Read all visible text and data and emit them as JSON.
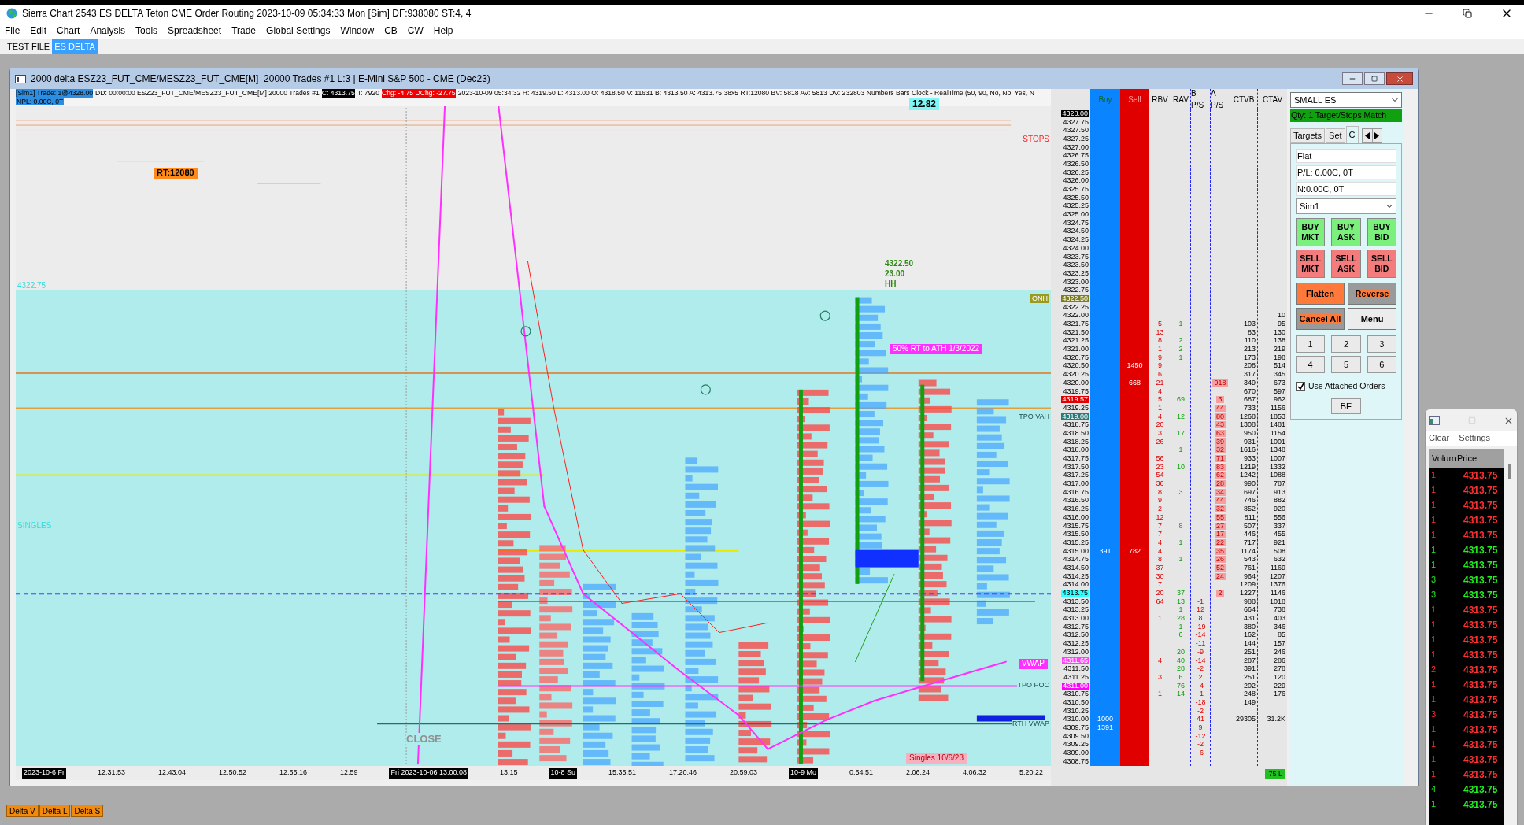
{
  "window": {
    "title": "Sierra Chart 2543 ES DELTA Teton CME Order Routing 2023-10-09 05:34:33 Mon [Sim] DF:938080 ST:4, 4"
  },
  "menu": [
    "File",
    "Edit",
    "Chart",
    "Analysis",
    "Tools",
    "Spreadsheet",
    "Trade",
    "Global Settings",
    "Window",
    "CB",
    "CW",
    "Help"
  ],
  "chartbook_tabs": [
    {
      "label": "TEST FILE",
      "selected": false
    },
    {
      "label": "ES DELTA",
      "selected": true
    }
  ],
  "chart": {
    "title": "2000 delta ESZ23_FUT_CME/MESZ23_FUT_CME[M]  20000 Trades #1 L:3 | E-Mini S&P 500 - CME (Dec23)",
    "info": [
      {
        "text": "[Sim1] Trade: 1@4328.00",
        "kind": "account"
      },
      {
        "text": "DD: 00:00:00 ESZ23_FUT_CME/MESZ23_FUT_CME[M] 20000 Trades #1",
        "kind": "plain"
      },
      {
        "text": "C: 4313.75",
        "kind": "close"
      },
      {
        "text": "T: 7920",
        "kind": "plain"
      },
      {
        "text": "Chg: -4.75 DChg: -27.75",
        "kind": "change"
      },
      {
        "text": "2023-10-09 05:34:32 H: 4319.50 L: 4313.00 O: 4318.50 V: 11631 B: 4313.50 A: 4313.75 38x5 RT:12080 BV: 5818 AV: 5813 DV: 232803 Numbers Bars Clock - RealTime (50, 90, No, No, Yes, N",
        "kind": "plain"
      }
    ],
    "info_line_2": "NPL: 0.00C, 0T",
    "labels": [
      {
        "text": "RT:12080",
        "kind": "tag"
      },
      {
        "text": "STOPS",
        "kind": "red"
      },
      {
        "text": "4322.75",
        "kind": "cyan"
      },
      {
        "text": "SINGLES",
        "kind": "cyan"
      },
      {
        "text": "CLOSE",
        "kind": "grey"
      },
      {
        "text": "12.82",
        "kind": "box"
      },
      {
        "text": "4322.50",
        "kind": "green"
      },
      {
        "text": "23.00",
        "kind": "green"
      },
      {
        "text": "HH",
        "kind": "green"
      },
      {
        "text": "ONH",
        "kind": "olive"
      },
      {
        "text": "50% RT to ATH 1/3/2022",
        "kind": "magenta"
      },
      {
        "text": "TPO VAH",
        "kind": "plain"
      },
      {
        "text": "VWAP",
        "kind": "magenta"
      },
      {
        "text": "TPO POC",
        "kind": "plain"
      },
      {
        "text": "RTH VWAP",
        "kind": "plain"
      },
      {
        "text": "Singles 10/6/23",
        "kind": "pink"
      }
    ],
    "x_axis": [
      {
        "text": "2023-10-6 Fr",
        "boxed": true
      },
      {
        "text": "12:31:53",
        "boxed": false
      },
      {
        "text": "12:43:04",
        "boxed": false
      },
      {
        "text": "12:50:52",
        "boxed": false
      },
      {
        "text": "12:55:16",
        "boxed": false
      },
      {
        "text": "12:59",
        "boxed": false
      },
      {
        "text": "Fri 2023-10-06 13:00:08",
        "boxed": true
      },
      {
        "text": "13:15",
        "boxed": false
      },
      {
        "text": "10-8 Su",
        "boxed": true
      },
      {
        "text": "15:35:51",
        "boxed": false
      },
      {
        "text": "17:20:46",
        "boxed": false
      },
      {
        "text": "20:59:03",
        "boxed": false
      },
      {
        "text": "10-9 Mo",
        "boxed": true
      },
      {
        "text": "0:54:51",
        "boxed": false
      },
      {
        "text": "2:06:24",
        "boxed": false
      },
      {
        "text": "4:06:32",
        "boxed": false
      },
      {
        "text": "5:20:22",
        "boxed": false
      }
    ]
  },
  "ladder": {
    "headers": [
      {
        "text": "Buy",
        "kind": "buy"
      },
      {
        "text": "Sell",
        "kind": "sell"
      },
      {
        "text": "RBV",
        "kind": "rbv"
      },
      {
        "text": "RAV",
        "kind": "rav"
      },
      {
        "text": "B P/S",
        "kind": "bps"
      },
      {
        "text": "A P/S",
        "kind": "aps"
      },
      {
        "text": "CTVB",
        "kind": "ctvb"
      },
      {
        "text": "CTAV",
        "kind": "ctav"
      }
    ],
    "rows": [
      {
        "price": "4328.00",
        "color": "#000000"
      },
      {
        "price": "4327.75"
      },
      {
        "price": "4327.50"
      },
      {
        "price": "4327.25"
      },
      {
        "price": "4327.00"
      },
      {
        "price": "4326.75"
      },
      {
        "price": "4326.50"
      },
      {
        "price": "4326.25"
      },
      {
        "price": "4326.00"
      },
      {
        "price": "4325.75"
      },
      {
        "price": "4325.50"
      },
      {
        "price": "4325.25"
      },
      {
        "price": "4325.00"
      },
      {
        "price": "4324.75"
      },
      {
        "price": "4324.50"
      },
      {
        "price": "4324.25"
      },
      {
        "price": "4324.00"
      },
      {
        "price": "4323.75"
      },
      {
        "price": "4323.50"
      },
      {
        "price": "4323.25"
      },
      {
        "price": "4323.00"
      },
      {
        "price": "4322.75"
      },
      {
        "price": "4322.50",
        "color": "#7d7d1a"
      },
      {
        "price": "4322.25"
      },
      {
        "price": "4322.00",
        "ctav": "10"
      },
      {
        "price": "4321.75",
        "rbv": "5",
        "rav": "1",
        "ctvb": "103",
        "ctav": "95"
      },
      {
        "price": "4321.50",
        "rbv": "13",
        "ctvb": "83",
        "ctav": "130"
      },
      {
        "price": "4321.25",
        "rbv": "8",
        "rav": "2",
        "ctvb": "110",
        "ctav": "138"
      },
      {
        "price": "4321.00",
        "rbv": "1",
        "rav": "2",
        "ctvb": "213",
        "ctav": "219"
      },
      {
        "price": "4320.75",
        "rbv": "9",
        "rav": "1",
        "ctvb": "173",
        "ctav": "198"
      },
      {
        "price": "4320.50",
        "sell": "1450",
        "rbv": "9",
        "ctvb": "208",
        "ctav": "514"
      },
      {
        "price": "4320.25",
        "rbv": "6",
        "ctvb": "317",
        "ctav": "345"
      },
      {
        "price": "4320.00",
        "sell": "668",
        "rbv": "21",
        "aps": "918",
        "ctvb": "349",
        "ctav": "673"
      },
      {
        "price": "4319.75",
        "rbv": "4",
        "ctvb": "670",
        "ctav": "597"
      },
      {
        "price": "4319.57",
        "color": "#e00000",
        "rbv": "5",
        "rav": "69",
        "aps": "3",
        "ctvb": "687",
        "ctav": "962"
      },
      {
        "price": "4319.25",
        "rbv": "1",
        "aps": "44",
        "ctvb": "733",
        "ctav": "1156"
      },
      {
        "price": "4319.00",
        "color": "#2a7a7a",
        "rbv": "4",
        "rav": "12",
        "aps": "80",
        "ctvb": "1268",
        "ctav": "1853"
      },
      {
        "price": "4318.75",
        "rbv": "20",
        "aps": "43",
        "ctvb": "1308",
        "ctav": "1481"
      },
      {
        "price": "4318.50",
        "rbv": "3",
        "rav": "17",
        "aps": "63",
        "ctvb": "950",
        "ctav": "1154"
      },
      {
        "price": "4318.25",
        "rbv": "26",
        "aps": "39",
        "ctvb": "931",
        "ctav": "1001"
      },
      {
        "price": "4318.00",
        "rav": "1",
        "aps": "32",
        "ctvb": "1616",
        "ctav": "1348"
      },
      {
        "price": "4317.75",
        "rbv": "56",
        "aps": "71",
        "ctvb": "933",
        "ctav": "1007"
      },
      {
        "price": "4317.50",
        "rbv": "23",
        "rav": "10",
        "aps": "83",
        "ctvb": "1219",
        "ctav": "1332"
      },
      {
        "price": "4317.25",
        "rbv": "54",
        "aps": "62",
        "ctvb": "1242",
        "ctav": "1088"
      },
      {
        "price": "4317.00",
        "rbv": "36",
        "aps": "28",
        "ctvb": "990",
        "ctav": "787"
      },
      {
        "price": "4316.75",
        "rbv": "8",
        "rav": "3",
        "aps": "34",
        "ctvb": "697",
        "ctav": "913"
      },
      {
        "price": "4316.50",
        "rbv": "9",
        "aps": "44",
        "ctvb": "746",
        "ctav": "882"
      },
      {
        "price": "4316.25",
        "rbv": "2",
        "aps": "32",
        "ctvb": "852",
        "ctav": "920"
      },
      {
        "price": "4316.00",
        "rbv": "12",
        "aps": "55",
        "ctvb": "811",
        "ctav": "556"
      },
      {
        "price": "4315.75",
        "rbv": "7",
        "rav": "8",
        "aps": "27",
        "ctvb": "507",
        "ctav": "337"
      },
      {
        "price": "4315.50",
        "rbv": "7",
        "aps": "17",
        "ctvb": "446",
        "ctav": "455"
      },
      {
        "price": "4315.25",
        "rbv": "4",
        "rav": "1",
        "aps": "22",
        "ctvb": "717",
        "ctav": "921"
      },
      {
        "price": "4315.00",
        "buy": "391",
        "sell": "782",
        "rbv": "4",
        "aps": "35",
        "ctvb": "1174",
        "ctav": "508"
      },
      {
        "price": "4314.75",
        "rbv": "8",
        "rav": "1",
        "aps": "26",
        "ctvb": "543",
        "ctav": "632"
      },
      {
        "price": "4314.50",
        "rbv": "37",
        "aps": "52",
        "ctvb": "761",
        "ctav": "1169"
      },
      {
        "price": "4314.25",
        "rbv": "30",
        "aps": "24",
        "ctvb": "964",
        "ctav": "1207"
      },
      {
        "price": "4314.00",
        "rbv": "7",
        "ctvb": "1209",
        "ctav": "1376"
      },
      {
        "price": "4313.75",
        "color": "#33ffff",
        "rbv": "20",
        "rav": "37",
        "aps": "2",
        "ctvb": "1227",
        "ctav": "1146"
      },
      {
        "price": "4313.50",
        "rbv": "64",
        "rav": "13",
        "bps": "-1",
        "ctvb": "988",
        "ctav": "1018"
      },
      {
        "price": "4313.25",
        "rav": "1",
        "bps": "12",
        "ctvb": "664",
        "ctav": "738"
      },
      {
        "price": "4313.00",
        "rbv": "1",
        "rav": "28",
        "bps": "8",
        "ctvb": "431",
        "ctav": "403"
      },
      {
        "price": "4312.75",
        "rav": "1",
        "bps": "-19",
        "ctvb": "380",
        "ctav": "346"
      },
      {
        "price": "4312.50",
        "rav": "6",
        "bps": "-14",
        "ctvb": "162",
        "ctav": "85"
      },
      {
        "price": "4312.25",
        "bps": "-11",
        "ctvb": "144",
        "ctav": "157"
      },
      {
        "price": "4312.00",
        "rav": "20",
        "bps": "-9",
        "ctvb": "251",
        "ctav": "246"
      },
      {
        "price": "4311.65",
        "color": "#ff40ff",
        "rbv": "4",
        "rav": "40",
        "bps": "-14",
        "ctvb": "287",
        "ctav": "286"
      },
      {
        "price": "4311.50",
        "rav": "28",
        "bps": "-2",
        "ctvb": "391",
        "ctav": "278"
      },
      {
        "price": "4311.25",
        "rbv": "3",
        "rav": "6",
        "bps": "2",
        "ctvb": "251",
        "ctav": "120"
      },
      {
        "price": "4311.00",
        "color": "#ff00ff",
        "rav": "76",
        "bps": "-4",
        "ctvb": "202",
        "ctav": "229"
      },
      {
        "price": "4310.75",
        "rbv": "1",
        "rav": "14",
        "bps": "-1",
        "ctvb": "248",
        "ctav": "176"
      },
      {
        "price": "4310.50",
        "bps": "-18",
        "ctvb": "149"
      },
      {
        "price": "4310.25",
        "bps": "-2"
      },
      {
        "price": "4310.00",
        "buy": "1000",
        "bps": "41",
        "ctvb": "29305",
        "ctav": "31.2K"
      },
      {
        "price": "4309.75",
        "buy": "1391",
        "bps": "9"
      },
      {
        "price": "4309.50",
        "bps": "-12"
      },
      {
        "price": "4309.25",
        "bps": "-2"
      },
      {
        "price": "4309.00",
        "bps": "-6"
      },
      {
        "price": "4308.75"
      }
    ],
    "footer": "75 L"
  },
  "order_panel": {
    "trade_window": "SMALL ES",
    "status": "Qty: 1 Target/Stops Match",
    "tabs": [
      {
        "label": "Targets",
        "selected": false
      },
      {
        "label": "Set",
        "selected": false
      },
      {
        "label": "C",
        "selected": true
      }
    ],
    "position": "Flat",
    "pl": "P/L: 0.00C, 0T",
    "net": "N:0.00C, 0T",
    "account": "Sim1",
    "order_buttons": [
      {
        "lines": [
          "BUY",
          "MKT"
        ],
        "kind": "buy"
      },
      {
        "lines": [
          "BUY",
          "ASK"
        ],
        "kind": "buy"
      },
      {
        "lines": [
          "BUY",
          "BID"
        ],
        "kind": "buy"
      },
      {
        "lines": [
          "SELL",
          "MKT"
        ],
        "kind": "sell"
      },
      {
        "lines": [
          "SELL",
          "ASK"
        ],
        "kind": "sell"
      },
      {
        "lines": [
          "SELL",
          "BID"
        ],
        "kind": "sell"
      }
    ],
    "actions": [
      {
        "label": "Flatten",
        "kind": "orange"
      },
      {
        "label": "Reverse",
        "kind": "highlight"
      },
      {
        "label": "Cancel All",
        "kind": "highlight"
      },
      {
        "label": "Menu",
        "kind": "plain"
      }
    ],
    "quantities": [
      "1",
      "2",
      "3",
      "4",
      "5",
      "6"
    ],
    "attached_orders": {
      "label": "Use Attached Orders",
      "checked": true
    },
    "be_button": "BE"
  },
  "time_and_sales": {
    "menu": [
      "Clear",
      "Settings"
    ],
    "columns": [
      "Volum",
      "Price"
    ],
    "rows": [
      {
        "volume": "1",
        "price": "4313.75",
        "color": "#ff3030"
      },
      {
        "volume": "1",
        "price": "4313.75",
        "color": "#ff3030"
      },
      {
        "volume": "1",
        "price": "4313.75",
        "color": "#ff3030"
      },
      {
        "volume": "1",
        "price": "4313.75",
        "color": "#ff3030"
      },
      {
        "volume": "1",
        "price": "4313.75",
        "color": "#ff3030"
      },
      {
        "volume": "1",
        "price": "4313.75",
        "color": "#22ee22"
      },
      {
        "volume": "1",
        "price": "4313.75",
        "color": "#22ee22"
      },
      {
        "volume": "3",
        "price": "4313.75",
        "color": "#22ee22"
      },
      {
        "volume": "3",
        "price": "4313.75",
        "color": "#22ee22"
      },
      {
        "volume": "1",
        "price": "4313.75",
        "color": "#ff3030"
      },
      {
        "volume": "1",
        "price": "4313.75",
        "color": "#ff3030"
      },
      {
        "volume": "1",
        "price": "4313.75",
        "color": "#ff3030"
      },
      {
        "volume": "1",
        "price": "4313.75",
        "color": "#ff3030"
      },
      {
        "volume": "2",
        "price": "4313.75",
        "color": "#ff3030"
      },
      {
        "volume": "1",
        "price": "4313.75",
        "color": "#ff3030"
      },
      {
        "volume": "1",
        "price": "4313.75",
        "color": "#ff3030"
      },
      {
        "volume": "3",
        "price": "4313.75",
        "color": "#ff3030"
      },
      {
        "volume": "1",
        "price": "4313.75",
        "color": "#ff3030"
      },
      {
        "volume": "1",
        "price": "4313.75",
        "color": "#ff3030"
      },
      {
        "volume": "1",
        "price": "4313.75",
        "color": "#ff3030"
      },
      {
        "volume": "1",
        "price": "4313.75",
        "color": "#ff3030"
      },
      {
        "volume": "4",
        "price": "4313.75",
        "color": "#22ee22"
      },
      {
        "volume": "1",
        "price": "4313.75",
        "color": "#22ee22"
      }
    ]
  },
  "bottom_tabs": [
    "Delta V",
    "Delta L",
    "Delta S"
  ]
}
